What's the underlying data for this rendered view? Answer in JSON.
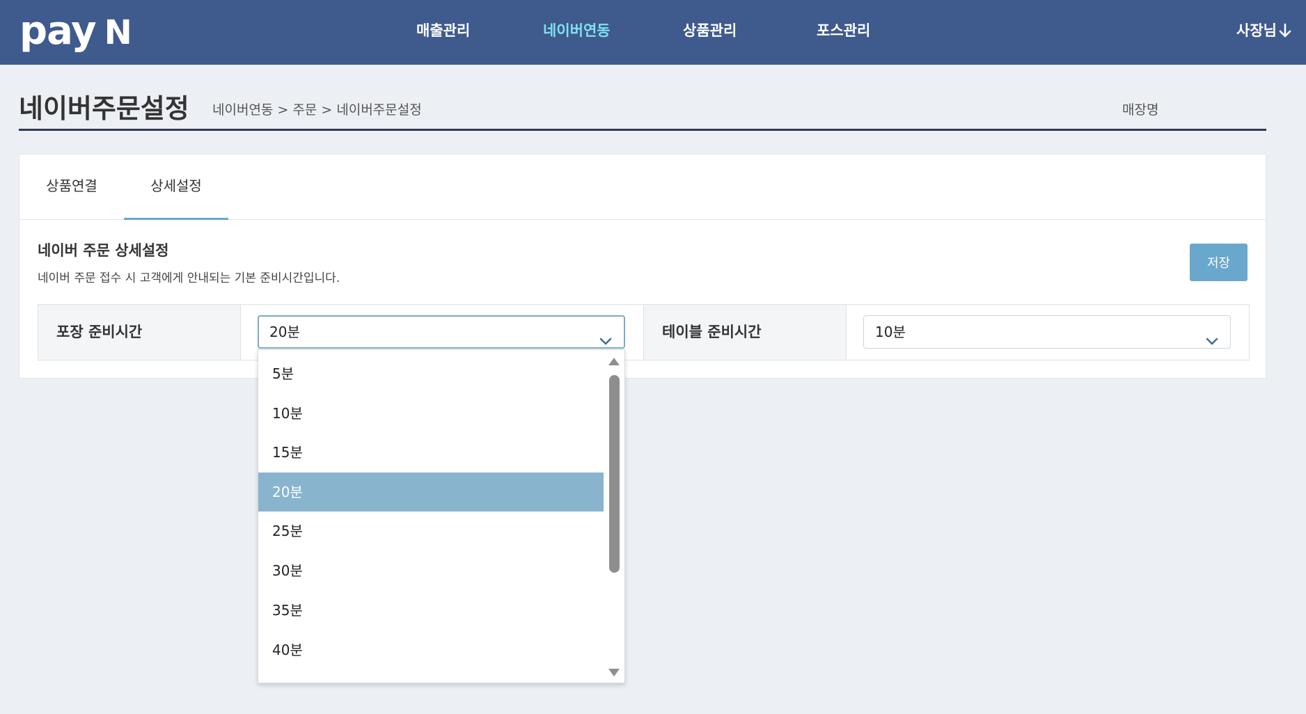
{
  "brand": {
    "logo_text": "pay",
    "logo_mark": "N"
  },
  "nav": {
    "items": [
      {
        "label": "매출관리"
      },
      {
        "label": "네이버연동"
      },
      {
        "label": "상품관리"
      },
      {
        "label": "포스관리"
      }
    ],
    "user_label": "사장님",
    "user_icon": "arrow-down-icon",
    "active_color": "#7fe0f0"
  },
  "header": {
    "title": "네이버주문설정",
    "breadcrumb": "네이버연동 > 주문 > 네이버주문설정",
    "store_label": "매장명"
  },
  "tabs": [
    {
      "label": "상품연결"
    },
    {
      "label": "상세설정"
    }
  ],
  "section": {
    "title": "네이버 주문 상세설정",
    "description": "네이버 주문 접수 시 고객에게 안내되는 기본 준비시간입니다.",
    "save_label": "저장"
  },
  "settings": {
    "packaging_label": "포장 준비시간",
    "packaging_value": "20분",
    "table_label": "테이블 준비시간",
    "table_value": "10분"
  },
  "dropdown": {
    "options": [
      "5분",
      "10분",
      "15분",
      "20분",
      "25분",
      "30분",
      "35분",
      "40분"
    ],
    "selected": "20분"
  },
  "colors": {
    "topbar": "#3f5a8d",
    "accent": "#6aa7cc",
    "selected_option": "#88b4ce"
  }
}
